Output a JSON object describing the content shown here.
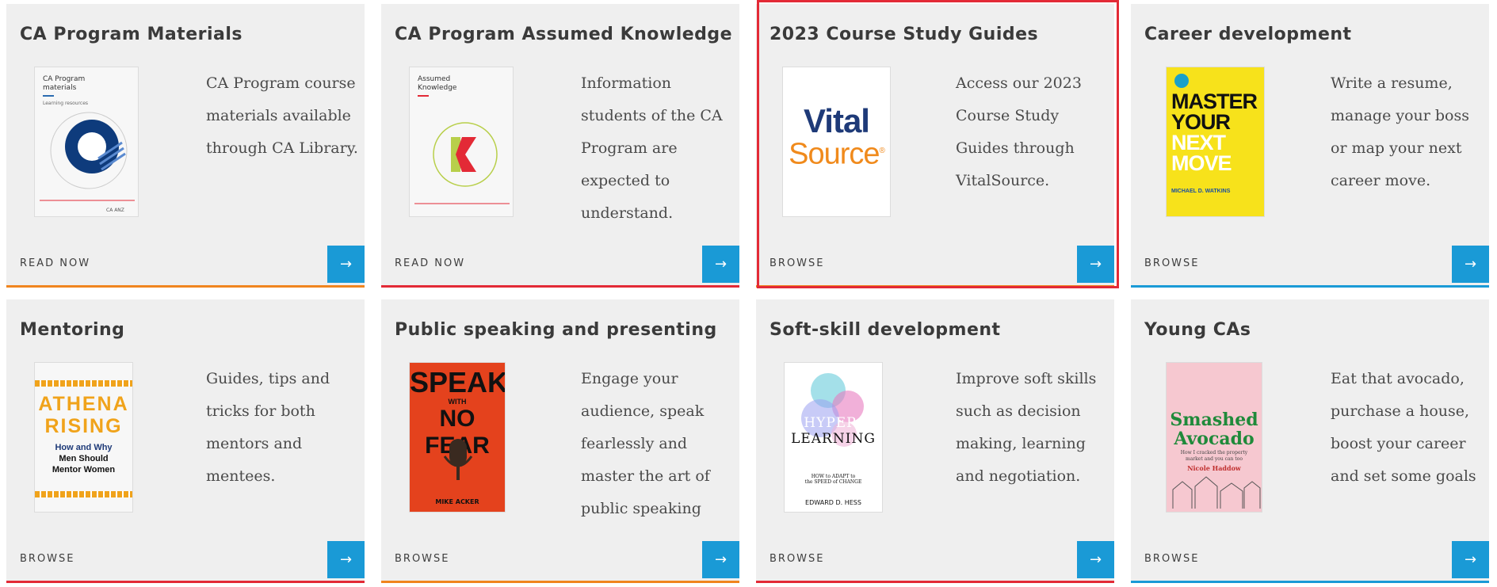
{
  "cards": [
    {
      "title": "CA Program Materials",
      "desc": "CA Program course materials available through CA Library.",
      "cta": "READ NOW",
      "bar_color": "#f0851f",
      "thumb": {
        "kind": "ca-materials",
        "line1": "CA Program",
        "line2": "materials",
        "line3": "Learning resources"
      }
    },
    {
      "title": "CA Program Assumed Knowledge",
      "desc": "Information students of the CA Program are expected to understand.",
      "cta": "READ NOW",
      "bar_color": "#e32a36",
      "thumb": {
        "kind": "assumed-knowledge",
        "line1": "Assumed",
        "line2": "Knowledge"
      }
    },
    {
      "title": "2023 Course Study Guides",
      "desc": "Access our 2023 Course Study Guides through VitalSource.",
      "cta": "BROWSE",
      "bar_color": "#f0851f",
      "thumb": {
        "kind": "vitalsource",
        "line1": "Vital",
        "line2": "Source",
        "reg": "®"
      }
    },
    {
      "title": "Career development",
      "desc": "Write a resume, manage your boss or map your next career move.",
      "cta": "BROWSE",
      "bar_color": "#1a9ad6",
      "thumb": {
        "kind": "master-move",
        "line1": "MASTER",
        "line2": "YOUR",
        "line3": "NEXT",
        "line4": "MOVE",
        "author": "MICHAEL D. WATKINS"
      }
    },
    {
      "title": "Mentoring",
      "desc": "Guides, tips and tricks for both mentors and mentees.",
      "cta": "BROWSE",
      "bar_color": "#e32a36",
      "thumb": {
        "kind": "athena",
        "line1": "ATHENA",
        "line2": "RISING",
        "line3": "How and Why",
        "line4": "Men Should",
        "line5": "Mentor Women"
      }
    },
    {
      "title": "Public speaking and presenting",
      "desc": "Engage your audience, speak fearlessly and master the art of public speaking",
      "cta": "BROWSE",
      "bar_color": "#f0851f",
      "thumb": {
        "kind": "speak",
        "line1": "SPEAK",
        "line2": "WITH",
        "line3": "NO FEAR",
        "author": "MIKE ACKER"
      }
    },
    {
      "title": "Soft-skill development",
      "desc": "Improve soft skills such as decision making, learning and negotiation.",
      "cta": "BROWSE",
      "bar_color": "#e32a36",
      "thumb": {
        "kind": "hyper",
        "line1": "HYPER-",
        "line2": "LEARNING",
        "line3": "HOW to ADAPT to",
        "line4": "the SPEED of CHANGE",
        "author": "EDWARD D. HESS"
      }
    },
    {
      "title": "Young CAs",
      "desc": "Eat that avocado, purchase a house, boost your career and set some goals",
      "cta": "BROWSE",
      "bar_color": "#1a9ad6",
      "thumb": {
        "kind": "avocado",
        "line1": "Smashed",
        "line2": "Avocado",
        "line3": "How I cracked the property market and you can too",
        "author": "Nicole Haddow"
      }
    }
  ],
  "arrow_glyph": "→",
  "colors": {
    "accent_blue": "#1a9ad6",
    "orange": "#f0851f",
    "red": "#e32a36",
    "card_bg": "#efefef"
  }
}
